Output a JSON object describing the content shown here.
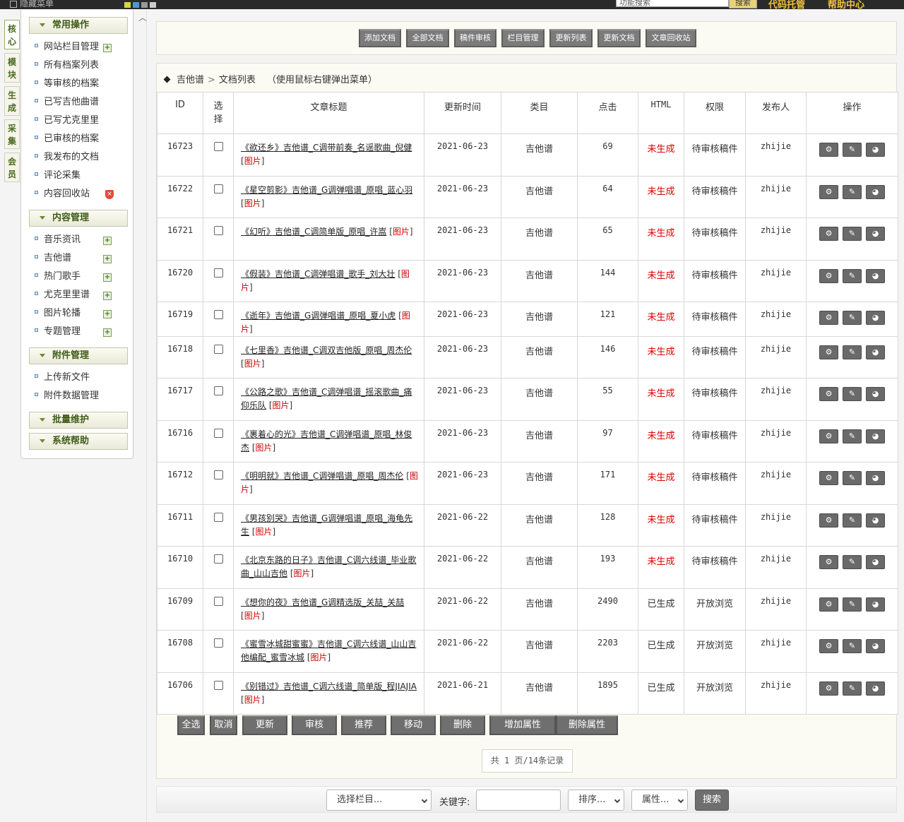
{
  "topbar": {
    "hide_menu": "隐藏菜单",
    "search_placeholder": "功能搜索",
    "search_button": "搜索",
    "links": [
      "代码托管",
      "帮助中心"
    ],
    "colors": [
      "#d4d44a",
      "#4a9ad4",
      "#999999",
      "#cccccc"
    ]
  },
  "vtabs": [
    "核心",
    "模块",
    "生成",
    "采集",
    "会员"
  ],
  "sidebar": {
    "sections": [
      {
        "title": "常用操作",
        "items": [
          {
            "label": "网站栏目管理",
            "icon": "add"
          },
          {
            "label": "所有档案列表",
            "icon": ""
          },
          {
            "label": "等审核的档案",
            "icon": ""
          },
          {
            "label": "已写吉他曲谱",
            "icon": ""
          },
          {
            "label": "已写尤克里里",
            "icon": ""
          },
          {
            "label": "已审核的档案",
            "icon": ""
          },
          {
            "label": "我发布的文档",
            "icon": ""
          },
          {
            "label": "评论采集",
            "icon": ""
          },
          {
            "label": "内容回收站",
            "icon": "bin"
          }
        ]
      },
      {
        "title": "内容管理",
        "items": [
          {
            "label": "音乐资讯",
            "icon": "add"
          },
          {
            "label": "吉他谱",
            "icon": "add"
          },
          {
            "label": "热门歌手",
            "icon": "add"
          },
          {
            "label": "尤克里里谱",
            "icon": "add"
          },
          {
            "label": "图片轮播",
            "icon": "add"
          },
          {
            "label": "专题管理",
            "icon": "add"
          }
        ]
      },
      {
        "title": "附件管理",
        "items": [
          {
            "label": "上传新文件",
            "icon": ""
          },
          {
            "label": "附件数据管理",
            "icon": ""
          }
        ]
      },
      {
        "title": "批量维护",
        "items": []
      },
      {
        "title": "系统帮助",
        "items": []
      }
    ]
  },
  "toolbar": [
    "添加文档",
    "全部文档",
    "稿件审核",
    "栏目管理",
    "更新列表",
    "更新文档",
    "文章回收站"
  ],
  "breadcrumb": {
    "root": "吉他谱",
    "sep": ">",
    "page": "文档列表",
    "hint": "（使用鼠标右键弹出菜单）"
  },
  "table": {
    "headers": [
      "ID",
      "选择",
      "文章标题",
      "更新时间",
      "类目",
      "点击",
      "HTML",
      "权限",
      "发布人",
      "操作"
    ],
    "img_tag": "图片",
    "rows": [
      {
        "id": "16723",
        "title": "《欲还乡》吉他谱_C调带前奏_名谣歌曲_倪健",
        "date": "2021-06-23",
        "cat": "吉他谱",
        "clicks": "69",
        "html": "未生成",
        "perm": "待审核稿件",
        "author": "zhijie"
      },
      {
        "id": "16722",
        "title": "《星空剪影》吉他谱_G调弹唱谱_原唱_蓝心羽",
        "date": "2021-06-23",
        "cat": "吉他谱",
        "clicks": "64",
        "html": "未生成",
        "perm": "待审核稿件",
        "author": "zhijie"
      },
      {
        "id": "16721",
        "title": "《幻听》吉他谱_C调简单版_原唱_许嵩",
        "date": "2021-06-23",
        "cat": "吉他谱",
        "clicks": "65",
        "html": "未生成",
        "perm": "待审核稿件",
        "author": "zhijie"
      },
      {
        "id": "16720",
        "title": "《假装》吉他谱_C调弹唱谱_歌手_刘大壮",
        "date": "2021-06-23",
        "cat": "吉他谱",
        "clicks": "144",
        "html": "未生成",
        "perm": "待审核稿件",
        "author": "zhijie"
      },
      {
        "id": "16719",
        "title": "《逝年》吉他谱_G调弹唱谱_原唱_夏小虎",
        "date": "2021-06-23",
        "cat": "吉他谱",
        "clicks": "121",
        "html": "未生成",
        "perm": "待审核稿件",
        "author": "zhijie"
      },
      {
        "id": "16718",
        "title": "《七里香》吉他谱_C调双吉他版_原唱_周杰伦",
        "date": "2021-06-23",
        "cat": "吉他谱",
        "clicks": "146",
        "html": "未生成",
        "perm": "待审核稿件",
        "author": "zhijie"
      },
      {
        "id": "16717",
        "title": "《公路之歌》吉他谱_C调弹唱谱_摇滚歌曲_痛仰乐队",
        "date": "2021-06-23",
        "cat": "吉他谱",
        "clicks": "55",
        "html": "未生成",
        "perm": "待审核稿件",
        "author": "zhijie"
      },
      {
        "id": "16716",
        "title": "《裹着心的光》吉他谱_C调弹唱谱_原唱_林俊杰",
        "date": "2021-06-23",
        "cat": "吉他谱",
        "clicks": "97",
        "html": "未生成",
        "perm": "待审核稿件",
        "author": "zhijie"
      },
      {
        "id": "16712",
        "title": "《明明就》吉他谱_C调弹唱谱_原唱_周杰伦",
        "date": "2021-06-23",
        "cat": "吉他谱",
        "clicks": "171",
        "html": "未生成",
        "perm": "待审核稿件",
        "author": "zhijie"
      },
      {
        "id": "16711",
        "title": "《男孩别哭》吉他谱_G调弹唱谱_原唱_海龟先生",
        "date": "2021-06-22",
        "cat": "吉他谱",
        "clicks": "128",
        "html": "未生成",
        "perm": "待审核稿件",
        "author": "zhijie"
      },
      {
        "id": "16710",
        "title": "《北京东路的日子》吉他谱_C调六线谱_毕业歌曲_山山吉他",
        "date": "2021-06-22",
        "cat": "吉他谱",
        "clicks": "193",
        "html": "未生成",
        "perm": "待审核稿件",
        "author": "zhijie"
      },
      {
        "id": "16709",
        "title": "《想你的夜》吉他谱_G调精选版_关喆_关喆",
        "date": "2021-06-22",
        "cat": "吉他谱",
        "clicks": "2490",
        "html": "已生成",
        "perm": "开放浏览",
        "author": "zhijie"
      },
      {
        "id": "16708",
        "title": "《蜜雪冰城甜蜜蜜》吉他谱_C调六线谱_山山吉他编配_蜜雪冰城",
        "date": "2021-06-22",
        "cat": "吉他谱",
        "clicks": "2203",
        "html": "已生成",
        "perm": "开放浏览",
        "author": "zhijie"
      },
      {
        "id": "16706",
        "title": "《别错过》吉他谱_C调六线谱_简单版_程JIAJIA",
        "date": "2021-06-21",
        "cat": "吉他谱",
        "clicks": "1895",
        "html": "已生成",
        "perm": "开放浏览",
        "author": "zhijie"
      }
    ],
    "row_icons": [
      "gear-icon",
      "edit-icon",
      "preview-icon"
    ]
  },
  "bottom_actions": [
    "全选",
    "取消",
    "更新",
    "审核",
    "推荐",
    "移动",
    "删除",
    "增加属性",
    "删除属性"
  ],
  "pager": "共 1 页/14条记录",
  "searchbar": {
    "category_select": "选择栏目...",
    "keyword_label": "关键字:",
    "sort_select": "排序...",
    "attr_select": "属性...",
    "submit": "搜索"
  },
  "colors": {
    "unbuilt": "#dd0000",
    "img_tag": "#cc0000",
    "section_text": "#3e5b17"
  }
}
